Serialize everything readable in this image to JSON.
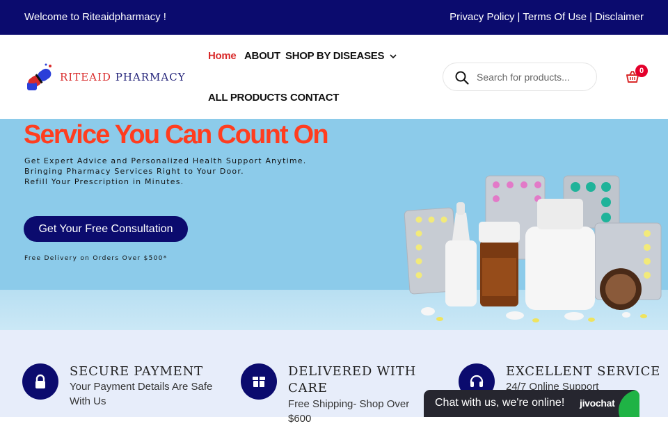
{
  "topbar": {
    "welcome": "Welcome to Riteaidpharmacy !",
    "links": [
      "Privacy Policy",
      "Terms Of Use",
      "Disclaimer"
    ],
    "separator": "|"
  },
  "header": {
    "logo": {
      "part1": "RITEAID",
      "part2": " PHARMACY"
    },
    "nav": {
      "home": "Home",
      "about": "ABOUT",
      "shop": "SHOP BY DISEASES",
      "all_products": "ALL PRODUCTS",
      "contact": "CONTACT"
    },
    "search": {
      "placeholder": "Search for products..."
    },
    "cart_count": "0"
  },
  "hero": {
    "title": "Service You Can Count On",
    "lines": [
      "Get Expert Advice and Personalized Health Support Anytime.",
      "Bringing Pharmacy Services Right to Your Door.",
      "Refill Your Prescription in Minutes."
    ],
    "cta": "Get Your Free Consultation",
    "note": "Free Delivery on Orders Over $500*"
  },
  "features": [
    {
      "title": "SECURE PAYMENT",
      "desc": "Your Payment Details Are Safe With Us",
      "icon": "lock-icon"
    },
    {
      "title": "DELIVERED WITH CARE",
      "desc": "Free Shipping- Shop Over $600",
      "icon": "box-icon"
    },
    {
      "title": "EXCELLENT SERVICE",
      "desc": "24/7 Online Support",
      "icon": "headset-icon"
    }
  ],
  "chat": {
    "message": "Chat with us, we're online!",
    "brand": "jivochat"
  },
  "colors": {
    "navy": "#0b0b6e",
    "accent_red": "#ff3d1f",
    "hero_bg": "#8ccbea",
    "features_bg": "#e7edfa"
  }
}
